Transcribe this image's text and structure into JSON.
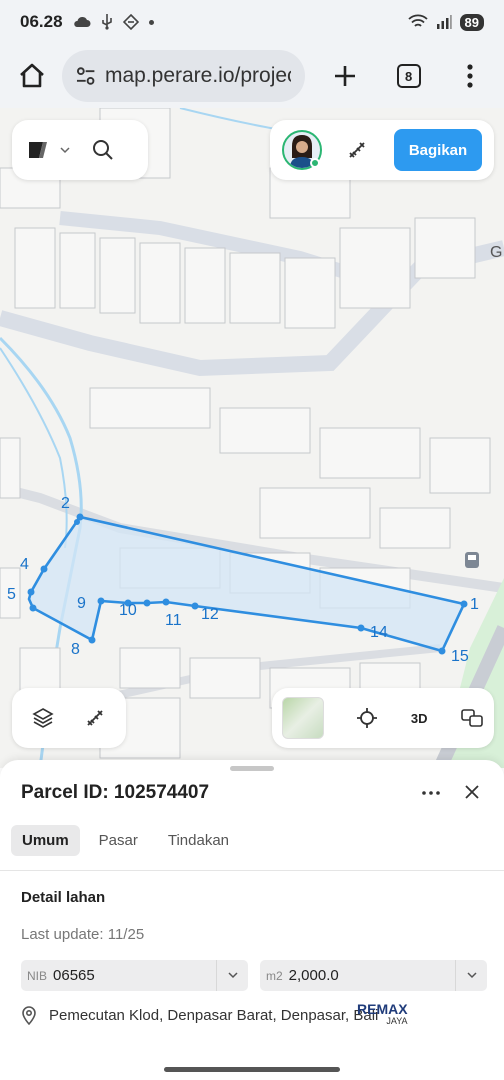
{
  "status_bar": {
    "time": "06.28",
    "battery": "89"
  },
  "browser": {
    "url": "map.perare.io/projec",
    "tab_count": "8"
  },
  "map": {
    "street_label": "G",
    "share_button": "Bagikan",
    "view_3d_label": "3D",
    "vertex_labels": [
      "1",
      "2",
      "4",
      "5",
      "8",
      "9",
      "10",
      "11",
      "12",
      "14",
      "15"
    ]
  },
  "parcel": {
    "title": "Parcel ID: 102574407",
    "tabs": [
      "Umum",
      "Pasar",
      "Tindakan"
    ],
    "active_tab": "Umum",
    "section_title": "Detail lahan",
    "last_update": "Last update: 11/25",
    "nib_prefix": "NIB",
    "nib_value": "06565",
    "area_unit": "m2",
    "area_value": "2,000.0",
    "address": "Pemecutan Klod, Denpasar Barat, Denpasar, Bali",
    "watermark": "REMAX",
    "watermark_sub": "JAYA"
  },
  "colors": {
    "accent": "#2d9af0",
    "parcel_line": "#2f8ee0"
  }
}
